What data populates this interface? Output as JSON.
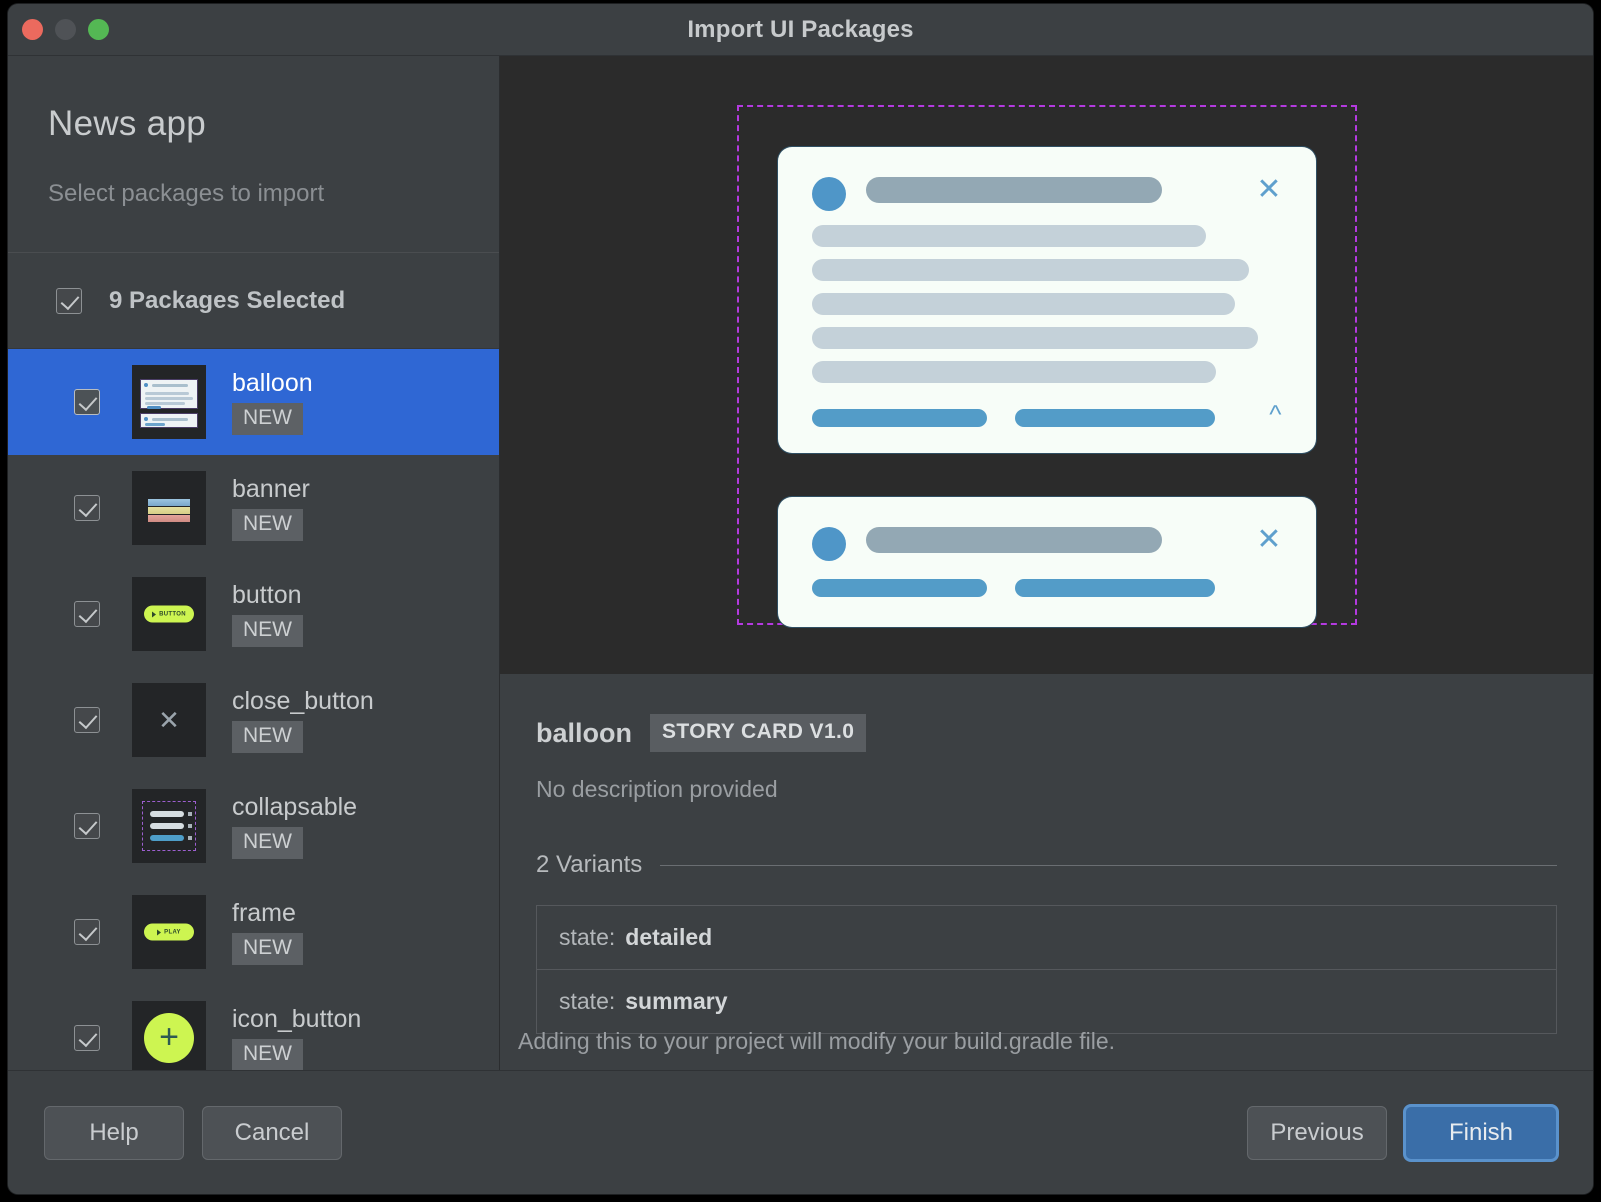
{
  "window": {
    "title": "Import UI Packages",
    "traffic_lights": [
      "close",
      "minimize",
      "zoom"
    ]
  },
  "sidebar": {
    "app_title": "News app",
    "subtitle": "Select packages to import",
    "selection_summary": "9 Packages Selected",
    "packages": [
      {
        "name": "balloon",
        "badge": "NEW",
        "checked": true,
        "selected": true,
        "thumb": "balloon-thumb"
      },
      {
        "name": "banner",
        "badge": "NEW",
        "checked": true,
        "selected": false,
        "thumb": "banner-thumb"
      },
      {
        "name": "button",
        "badge": "NEW",
        "checked": true,
        "selected": false,
        "thumb": "button-thumb",
        "thumb_label": "BUTTON"
      },
      {
        "name": "close_button",
        "badge": "NEW",
        "checked": true,
        "selected": false,
        "thumb": "close-thumb"
      },
      {
        "name": "collapsable",
        "badge": "NEW",
        "checked": true,
        "selected": false,
        "thumb": "collapsable-thumb"
      },
      {
        "name": "frame",
        "badge": "NEW",
        "checked": true,
        "selected": false,
        "thumb": "frame-thumb",
        "thumb_label": "PLAY"
      },
      {
        "name": "icon_button",
        "badge": "NEW",
        "checked": true,
        "selected": false,
        "thumb": "icon-button-thumb"
      }
    ]
  },
  "preview": {
    "cards": [
      {
        "name": "detailed-card",
        "close_icon": "✕",
        "chevron_icon": "∧",
        "body_line_widths": [
          "84%",
          "93%",
          "90%",
          "95%",
          "86%"
        ],
        "action_widths": [
          "175px",
          "200px"
        ]
      },
      {
        "name": "summary-card",
        "close_icon": "✕",
        "body_line_widths": [],
        "action_widths": [
          "175px",
          "200px"
        ]
      }
    ]
  },
  "details": {
    "name": "balloon",
    "tag": "STORY CARD V1.0",
    "description": "No description provided",
    "variants_heading": "2 Variants",
    "variants": [
      {
        "key": "state:",
        "value": "detailed"
      },
      {
        "key": "state:",
        "value": "summary"
      }
    ]
  },
  "footer": {
    "note": "Adding this to your project will modify your build.gradle file.",
    "help_label": "Help",
    "cancel_label": "Cancel",
    "previous_label": "Previous",
    "finish_label": "Finish"
  },
  "colors": {
    "window_bg": "#3c4043",
    "preview_bg": "#2b2b2b",
    "selection_blue": "#2f67d4",
    "accent_blue": "#3a6ea8",
    "dash_purple": "#b43ae0",
    "card_bg": "#f7fdf8",
    "lime": "#cdf551"
  }
}
